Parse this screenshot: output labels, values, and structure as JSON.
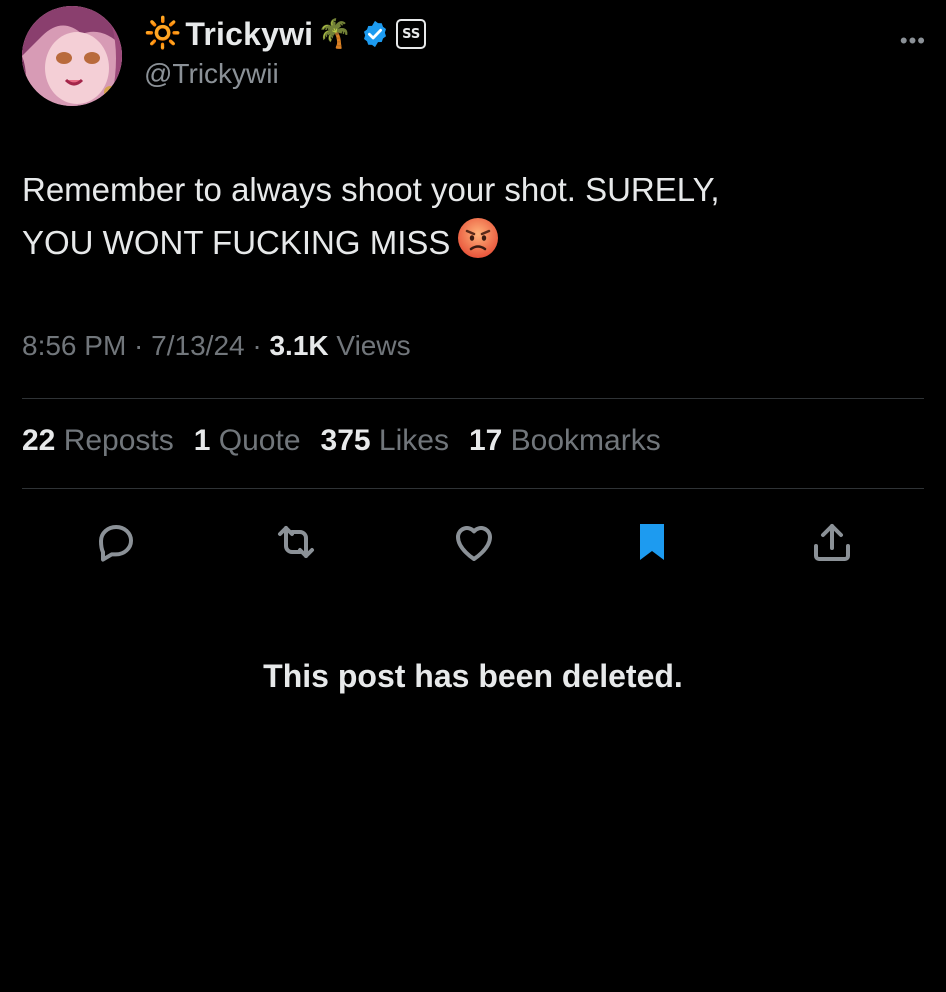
{
  "author": {
    "sun_glyph": "🔆",
    "display_name": "Trickywi",
    "palm_glyph": "🌴",
    "affiliate_badge": "SS",
    "handle": "@Trickywii",
    "avatar_icon": "avatar-anime-girl"
  },
  "more_glyph": "•••",
  "tweet": {
    "line1": "Remember to always shoot your shot. SURELY,",
    "line2": "YOU WONT FUCKING MISS"
  },
  "meta": {
    "time": "8:56 PM",
    "sep1": " · ",
    "date": "7/13/24",
    "sep2": " · ",
    "views_count": "3.1K",
    "views_label": " Views"
  },
  "stats": {
    "reposts_num": "22",
    "reposts_label": " Reposts",
    "quotes_num": "1",
    "quotes_label": " Quote",
    "likes_num": "375",
    "likes_label": " Likes",
    "bookmarks_num": "17",
    "bookmarks_label": " Bookmarks"
  },
  "actions": [
    "reply-icon",
    "repost-icon",
    "like-icon",
    "bookmark-icon",
    "share-icon"
  ],
  "colors": {
    "background": "#000000",
    "text": "#e7e9ea",
    "muted": "#71767b",
    "accent_blue": "#1d9bf0",
    "verified_blue": "#1d9bf0"
  },
  "deleted_message": "This post has been deleted."
}
